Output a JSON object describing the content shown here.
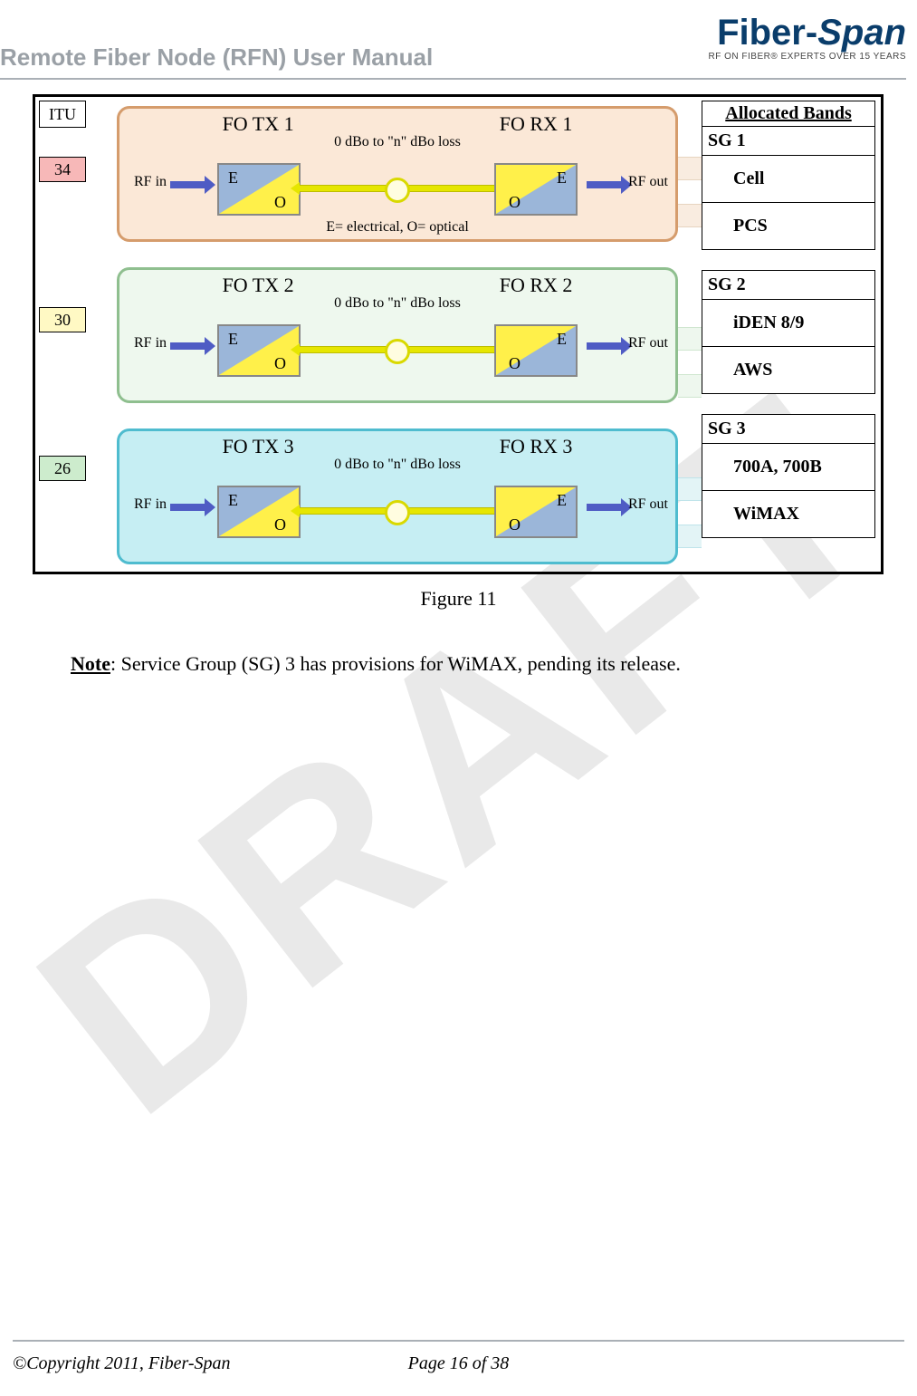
{
  "header": {
    "title": "Remote Fiber Node (RFN) User Manual",
    "logo_brand": "Fiber-Span",
    "logo_tag": "RF ON FIBER® EXPERTS OVER 15 YEARS"
  },
  "watermark": "DRAFT",
  "figure": {
    "caption": "Figure 11",
    "itu_header": "ITU",
    "itu_values": {
      "g1": "34",
      "g2": "30",
      "g3": "26"
    },
    "loss_text": "0 dBo to \"n\" dBo loss",
    "eo_legend": "E= electrical, O= optical",
    "rf_in": "RF in",
    "rf_out": "RF out",
    "E": "E",
    "O": "O",
    "groups": {
      "g1": {
        "tx": "FO TX 1",
        "rx": "FO RX 1"
      },
      "g2": {
        "tx": "FO TX 2",
        "rx": "FO RX 2"
      },
      "g3": {
        "tx": "FO TX 3",
        "rx": "FO RX 3"
      }
    },
    "alloc": {
      "header": "Allocated Bands",
      "sg1": "SG 1",
      "sg1_a": "Cell",
      "sg1_b": "PCS",
      "sg2": "SG 2",
      "sg2_a": "iDEN 8/9",
      "sg2_b": "AWS",
      "sg3": "SG 3",
      "sg3_a": "700A, 700B",
      "sg3_b": "WiMAX"
    }
  },
  "note": {
    "label": "Note",
    "text": ": Service Group (SG) 3 has provisions for WiMAX, pending its release."
  },
  "footer": {
    "copyright": "©Copyright 2011, Fiber-Span",
    "page": "Page 16 of 38"
  }
}
